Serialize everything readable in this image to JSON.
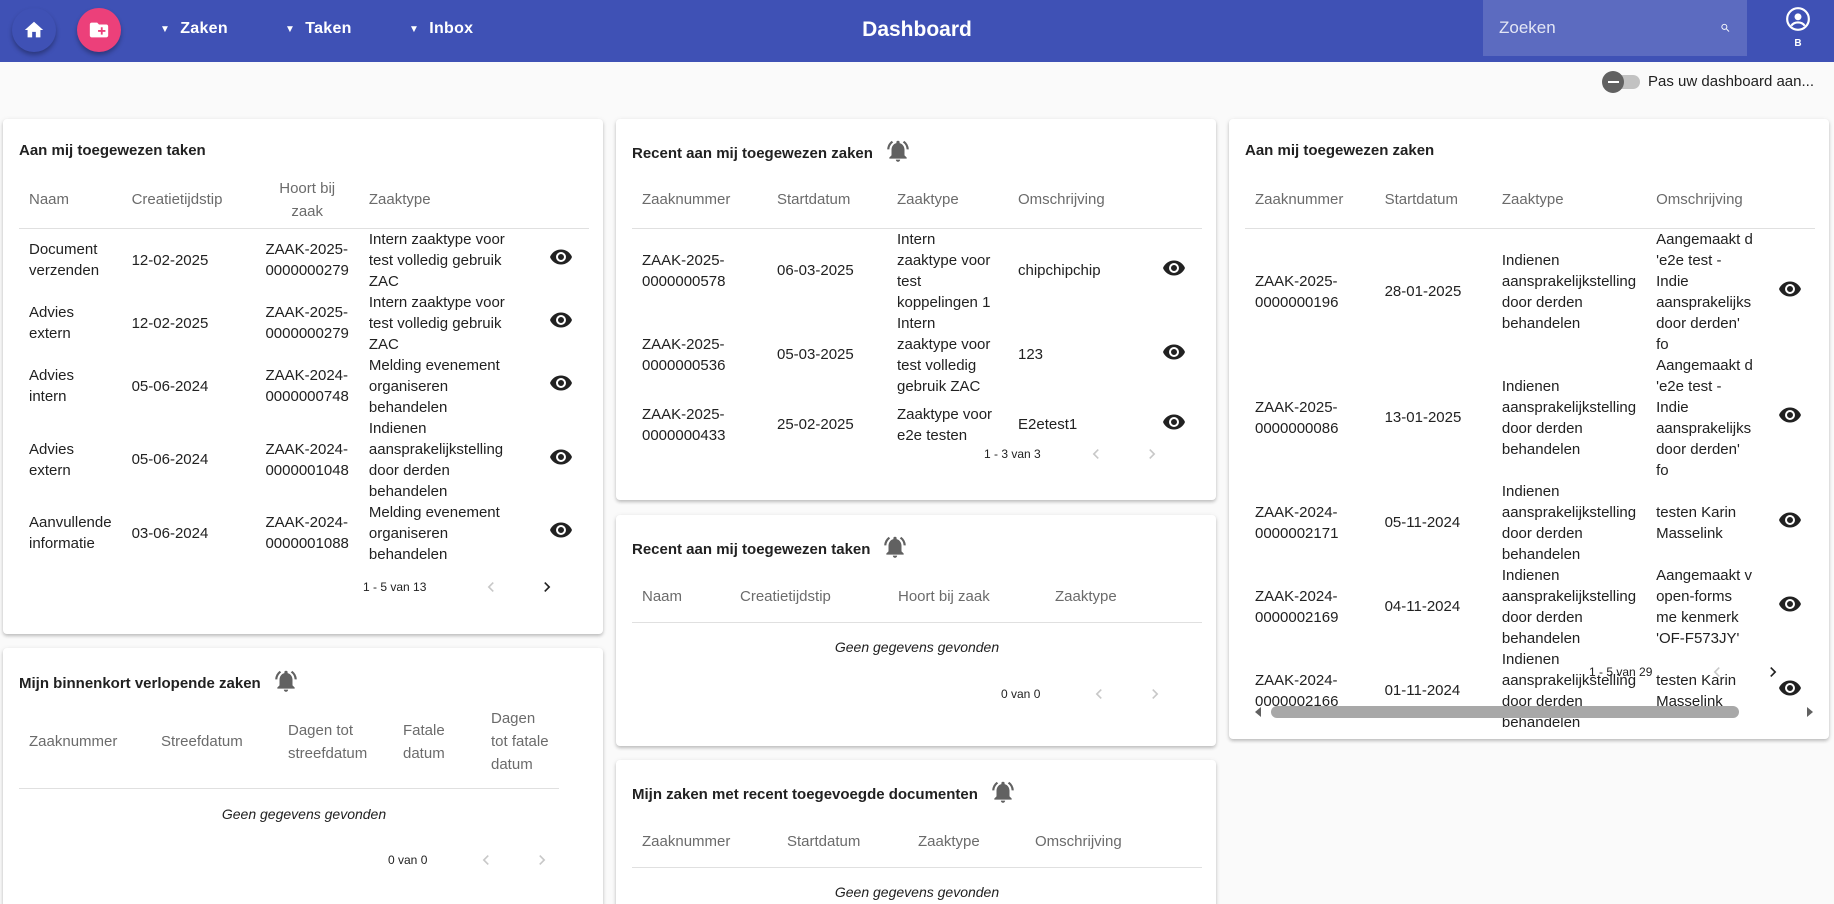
{
  "toolbar": {
    "title": "Dashboard",
    "menus": [
      {
        "label": "Zaken"
      },
      {
        "label": "Taken"
      },
      {
        "label": "Inbox"
      }
    ],
    "search_placeholder": "Zoeken",
    "user_initial": "B",
    "colors": {
      "primary": "#3f51b5",
      "accent": "#ec407a"
    }
  },
  "customize": {
    "label": "Pas uw dashboard aan..."
  },
  "cards": {
    "my_tasks": {
      "title": "Aan mij toegewezen taken",
      "headers": [
        "Naam",
        "Creatietijdstip",
        "Hoort bij zaak",
        "Zaaktype"
      ],
      "rows": [
        {
          "naam": "Document verzenden",
          "datum": "12-02-2025",
          "zaak": "ZAAK-2025-0000000279",
          "zaaktype": "Intern zaaktype voor test volledig gebruik ZAC"
        },
        {
          "naam": "Advies extern",
          "datum": "12-02-2025",
          "zaak": "ZAAK-2025-0000000279",
          "zaaktype": "Intern zaaktype voor test volledig gebruik ZAC"
        },
        {
          "naam": "Advies intern",
          "datum": "05-06-2024",
          "zaak": "ZAAK-2024-0000000748",
          "zaaktype": "Melding evenement organiseren behandelen"
        },
        {
          "naam": "Advies extern",
          "datum": "05-06-2024",
          "zaak": "ZAAK-2024-0000001048",
          "zaaktype": "Indienen aansprakelijkstelling door derden behandelen"
        },
        {
          "naam": "Aanvullende informatie",
          "datum": "03-06-2024",
          "zaak": "ZAAK-2024-0000001088",
          "zaaktype": "Melding evenement organiseren behandelen"
        }
      ],
      "pager": "1 - 5 van 13"
    },
    "expiring": {
      "title": "Mijn binnenkort verlopende zaken",
      "headers": [
        "Zaaknummer",
        "Streefdatum",
        "Dagen tot streefdatum",
        "Fatale datum",
        "Dagen tot fatale datum"
      ],
      "empty": "Geen gegevens gevonden",
      "pager": "0 van 0"
    },
    "recent_cases": {
      "title": "Recent aan mij toegewezen zaken",
      "headers": [
        "Zaaknummer",
        "Startdatum",
        "Zaaktype",
        "Omschrijving"
      ],
      "rows": [
        {
          "nummer": "ZAAK-2025-0000000578",
          "start": "06-03-2025",
          "zaaktype": "Intern zaaktype voor test koppelingen 1",
          "omschrijving": "chipchipchip"
        },
        {
          "nummer": "ZAAK-2025-0000000536",
          "start": "05-03-2025",
          "zaaktype": "Intern zaaktype voor test volledig gebruik ZAC",
          "omschrijving": "123"
        },
        {
          "nummer": "ZAAK-2025-0000000433",
          "start": "25-02-2025",
          "zaaktype": "Zaaktype voor e2e testen",
          "omschrijving": "E2etest1"
        }
      ],
      "pager": "1 - 3 van 3"
    },
    "recent_tasks": {
      "title": "Recent aan mij toegewezen taken",
      "headers": [
        "Naam",
        "Creatietijdstip",
        "Hoort bij zaak",
        "Zaaktype"
      ],
      "empty": "Geen gegevens gevonden",
      "pager": "0 van 0"
    },
    "recent_docs": {
      "title": "Mijn zaken met recent toegevoegde documenten",
      "headers": [
        "Zaaknummer",
        "Startdatum",
        "Zaaktype",
        "Omschrijving"
      ],
      "empty": "Geen gegevens gevonden"
    },
    "my_cases": {
      "title": "Aan mij toegewezen zaken",
      "headers": [
        "Zaaknummer",
        "Startdatum",
        "Zaaktype",
        "Omschrijving"
      ],
      "rows": [
        {
          "nummer": "ZAAK-2025-0000000196",
          "start": "28-01-2025",
          "zaaktype": "Indienen aansprakelijkstelling door derden behandelen",
          "omschrijving": "Aangemaakt d 'e2e test - Indie aansprakelijks door derden' fo"
        },
        {
          "nummer": "ZAAK-2025-0000000086",
          "start": "13-01-2025",
          "zaaktype": "Indienen aansprakelijkstelling door derden behandelen",
          "omschrijving": "Aangemaakt d 'e2e test - Indie aansprakelijks door derden' fo"
        },
        {
          "nummer": "ZAAK-2024-0000002171",
          "start": "05-11-2024",
          "zaaktype": "Indienen aansprakelijkstelling door derden behandelen",
          "omschrijving": "testen Karin Masselink"
        },
        {
          "nummer": "ZAAK-2024-0000002169",
          "start": "04-11-2024",
          "zaaktype": "Indienen aansprakelijkstelling door derden behandelen",
          "omschrijving": "Aangemaakt v open-forms me kenmerk 'OF-F573JY'"
        },
        {
          "nummer": "ZAAK-2024-0000002166",
          "start": "01-11-2024",
          "zaaktype": "Indienen aansprakelijkstelling door derden behandelen",
          "omschrijving": "testen Karin Masselink"
        }
      ],
      "pager": "1 - 5 van 29"
    }
  }
}
